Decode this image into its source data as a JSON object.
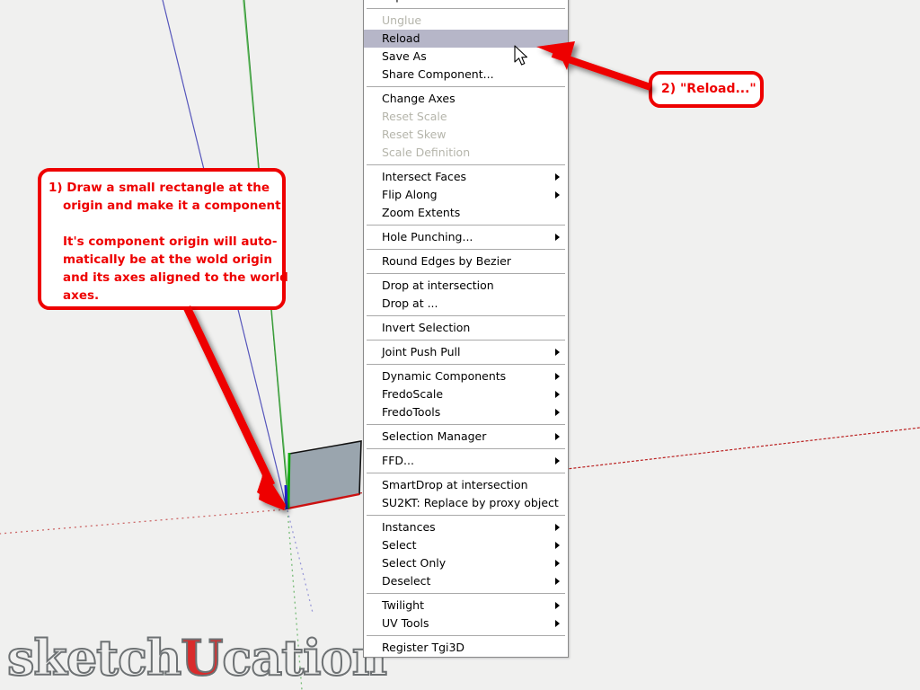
{
  "app": {
    "background_color": "#f0f0ef",
    "watermark": {
      "prefix": "sketch",
      "accent": "U",
      "suffix": "cation",
      "accent_color": "#d92b2b"
    }
  },
  "context_menu": {
    "highlight_color": "#b6b6c8",
    "groups": [
      {
        "items": [
          {
            "label": "Explode",
            "state": "normal",
            "submenu": false
          }
        ]
      },
      {
        "items": [
          {
            "label": "Unglue",
            "state": "disabled",
            "submenu": false
          },
          {
            "label": "Reload",
            "state": "highlight",
            "submenu": false
          },
          {
            "label": "Save As",
            "state": "normal",
            "submenu": false
          },
          {
            "label": "Share Component...",
            "state": "normal",
            "submenu": false
          }
        ]
      },
      {
        "items": [
          {
            "label": "Change Axes",
            "state": "normal",
            "submenu": false
          },
          {
            "label": "Reset Scale",
            "state": "disabled",
            "submenu": false
          },
          {
            "label": "Reset Skew",
            "state": "disabled",
            "submenu": false
          },
          {
            "label": "Scale Definition",
            "state": "disabled",
            "submenu": false
          }
        ]
      },
      {
        "items": [
          {
            "label": "Intersect Faces",
            "state": "normal",
            "submenu": true
          },
          {
            "label": "Flip Along",
            "state": "normal",
            "submenu": true
          },
          {
            "label": "Zoom Extents",
            "state": "normal",
            "submenu": false
          }
        ]
      },
      {
        "items": [
          {
            "label": "Hole Punching...",
            "state": "normal",
            "submenu": true
          }
        ]
      },
      {
        "items": [
          {
            "label": "Round Edges by Bezier",
            "state": "normal",
            "submenu": false
          }
        ]
      },
      {
        "items": [
          {
            "label": "Drop at intersection",
            "state": "normal",
            "submenu": false
          },
          {
            "label": "Drop at ...",
            "state": "normal",
            "submenu": false
          }
        ]
      },
      {
        "items": [
          {
            "label": "Invert Selection",
            "state": "normal",
            "submenu": false
          }
        ]
      },
      {
        "items": [
          {
            "label": "Joint Push Pull",
            "state": "normal",
            "submenu": true
          }
        ]
      },
      {
        "items": [
          {
            "label": "Dynamic Components",
            "state": "normal",
            "submenu": true
          },
          {
            "label": "FredoScale",
            "state": "normal",
            "submenu": true
          },
          {
            "label": "FredoTools",
            "state": "normal",
            "submenu": true
          }
        ]
      },
      {
        "items": [
          {
            "label": "Selection Manager",
            "state": "normal",
            "submenu": true
          }
        ]
      },
      {
        "items": [
          {
            "label": "FFD...",
            "state": "normal",
            "submenu": true
          }
        ]
      },
      {
        "items": [
          {
            "label": "SmartDrop at intersection",
            "state": "normal",
            "submenu": false
          },
          {
            "label": "SU2KT: Replace by proxy object",
            "state": "normal",
            "submenu": false
          }
        ]
      },
      {
        "items": [
          {
            "label": "Instances",
            "state": "normal",
            "submenu": true
          },
          {
            "label": "Select",
            "state": "normal",
            "submenu": true
          },
          {
            "label": "Select Only",
            "state": "normal",
            "submenu": true
          },
          {
            "label": "Deselect",
            "state": "normal",
            "submenu": true
          }
        ]
      },
      {
        "items": [
          {
            "label": "Twilight",
            "state": "normal",
            "submenu": true
          },
          {
            "label": "UV Tools",
            "state": "normal",
            "submenu": true
          }
        ]
      },
      {
        "items": [
          {
            "label": "Register Tgi3D",
            "state": "normal",
            "submenu": false
          }
        ]
      }
    ]
  },
  "callouts": {
    "one": {
      "line1": "1) Draw a small rectangle at the",
      "line2": "origin and make it a component.",
      "line3": "It's component origin will auto-",
      "line4": "matically be at the wold origin",
      "line5": "and its axes aligned to the world",
      "line6": "axes.",
      "border_color": "#ee0000"
    },
    "two": {
      "text": "2) \"Reload...\"",
      "border_color": "#ee0000"
    }
  },
  "viewport": {
    "axis_red_color": "#cc0000",
    "axis_green_color": "#00a000",
    "axis_blue_color": "#3333cc",
    "face_fill": "#9aa5ae",
    "edge_color": "#101010"
  }
}
